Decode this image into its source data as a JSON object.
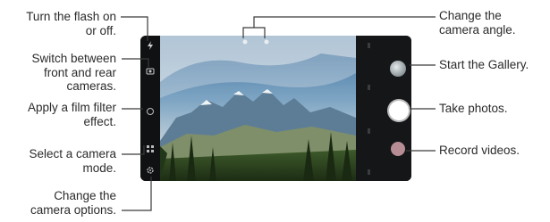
{
  "callouts": {
    "flash": [
      "Turn the flash on",
      "or off."
    ],
    "switch": [
      "Switch between",
      "front and rear",
      "cameras."
    ],
    "filter": [
      "Apply a film filter",
      "effect."
    ],
    "mode": [
      "Select a camera",
      "mode."
    ],
    "options": [
      "Change the",
      "camera options."
    ],
    "angle": [
      "Change the",
      "camera angle."
    ],
    "gallery": [
      "Start the Gallery."
    ],
    "take": [
      "Take photos."
    ],
    "record": [
      "Record videos."
    ]
  },
  "colors": {
    "callout_line": "#3a3a3a",
    "screen_bg": "#0f0f10",
    "record_button": "#b68d95"
  },
  "icons": {
    "flash": "flash-icon",
    "switch": "camera-switch-icon",
    "filter": "film-filter-icon",
    "mode": "camera-mode-icon",
    "options": "settings-icon",
    "angle": "wide-angle-icon"
  }
}
